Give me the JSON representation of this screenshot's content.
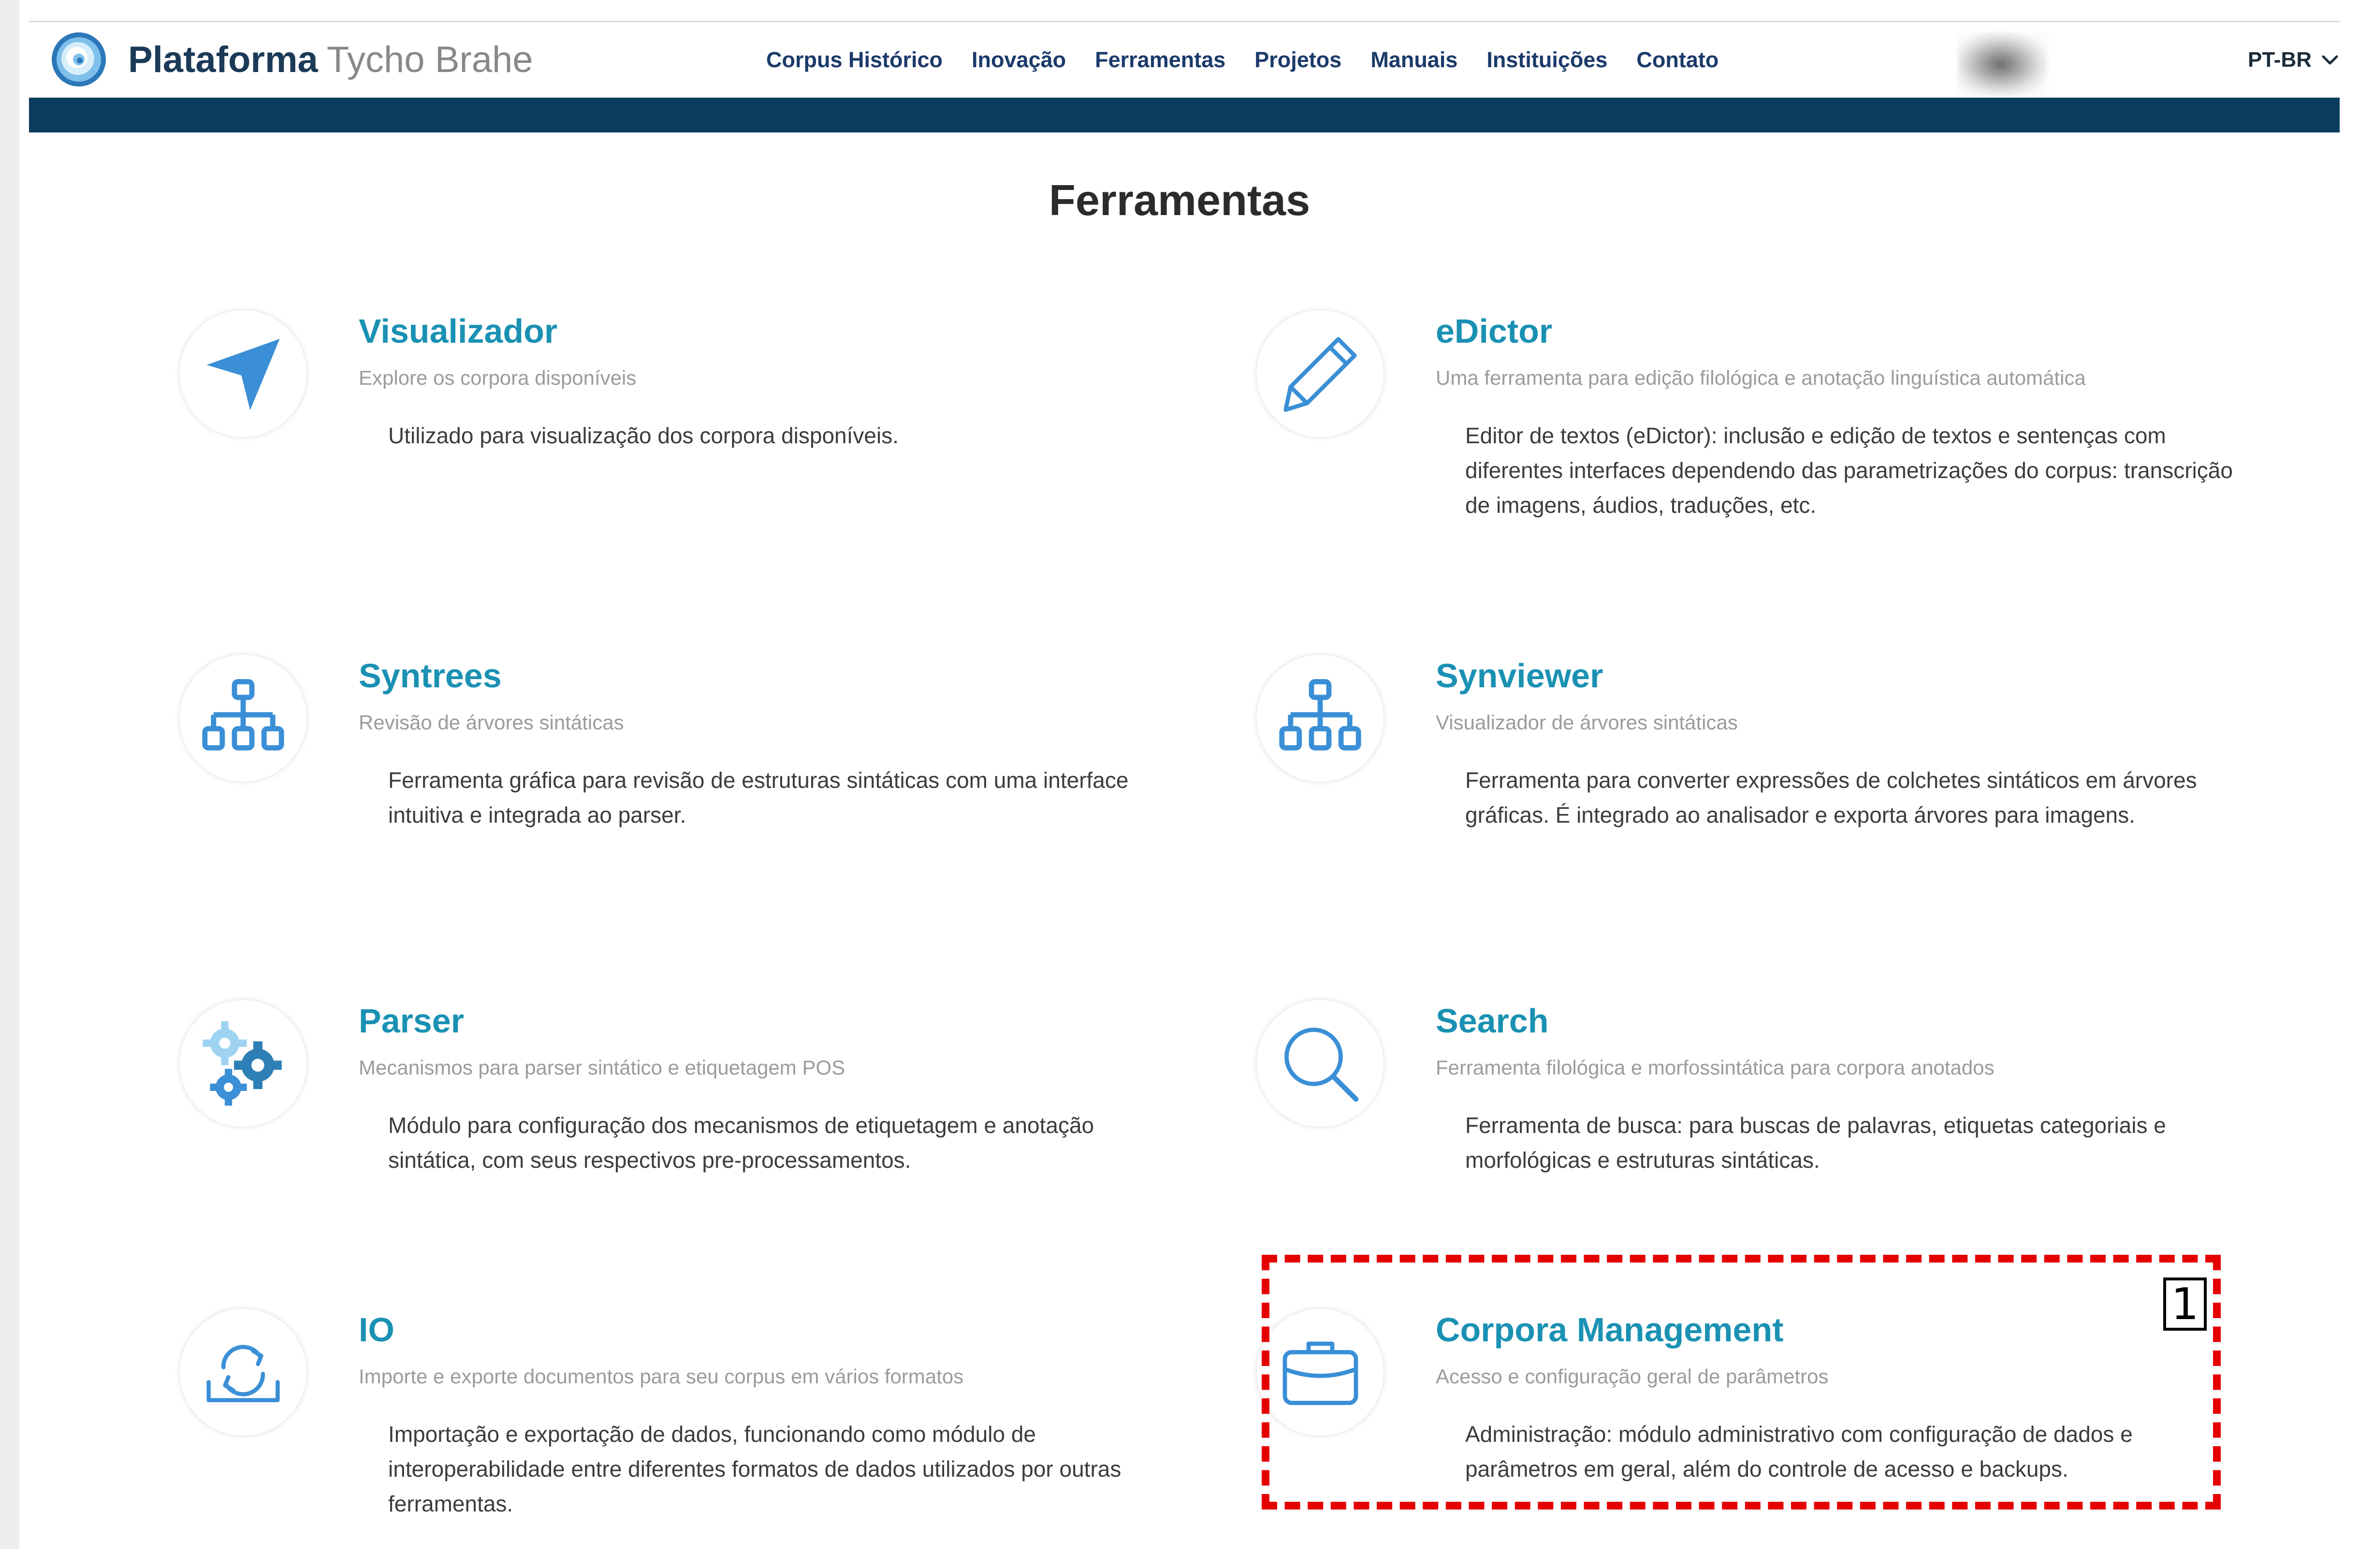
{
  "header": {
    "brand_bold": "Plataforma",
    "brand_light": "Tycho Brahe",
    "nav": [
      {
        "label": "Corpus Histórico"
      },
      {
        "label": "Inovação"
      },
      {
        "label": "Ferramentas"
      },
      {
        "label": "Projetos"
      },
      {
        "label": "Manuais"
      },
      {
        "label": "Instituições"
      },
      {
        "label": "Contato"
      }
    ],
    "language": "PT-BR",
    "accent_color": "#0c3c5d"
  },
  "page": {
    "title": "Ferramentas"
  },
  "tools": [
    {
      "title": "Visualizador",
      "subtitle": "Explore os corpora disponíveis",
      "description": "Utilizado para visualização dos corpora disponíveis.",
      "icon": "paper-plane-icon"
    },
    {
      "title": "eDictor",
      "subtitle": "Uma ferramenta para edição filológica e anotação linguística automática",
      "description": "Editor de textos (eDictor): inclusão e edição de textos e sentenças com diferentes interfaces dependendo das parametrizações do corpus: transcrição de imagens, áudios, traduções, etc.",
      "icon": "pencil-icon"
    },
    {
      "title": "Syntrees",
      "subtitle": "Revisão de árvores sintáticas",
      "description": "Ferramenta gráfica para revisão de estruturas sintáticas com uma interface intuitiva e integrada ao parser.",
      "icon": "tree-structure-icon"
    },
    {
      "title": "Synviewer",
      "subtitle": "Visualizador de árvores sintáticas",
      "description": "Ferramenta para converter expressões de colchetes sintáticos em árvores gráficas. É integrado ao analisador e exporta árvores para imagens.",
      "icon": "tree-structure-icon"
    },
    {
      "title": "Parser",
      "subtitle": "Mecanismos para parser sintático e etiquetagem POS",
      "description": "Módulo para configuração dos mecanismos de etiquetagem e anotação sintática, com seus respectivos pre-processamentos.",
      "icon": "gears-icon"
    },
    {
      "title": "Search",
      "subtitle": "Ferramenta filológica e morfossintática para corpora anotados",
      "description": "Ferramenta de busca: para buscas de palavras, etiquetas categoriais e morfológicas e estruturas sintáticas.",
      "icon": "magnifier-icon"
    },
    {
      "title": "IO",
      "subtitle": "Importe e exporte documentos para seu corpus em vários formatos",
      "description": "Importação e exportação de dados, funcionando como módulo de interoperabilidade entre diferentes formatos de dados utilizados por outras ferramentas.",
      "icon": "import-export-icon"
    },
    {
      "title": "Corpora Management",
      "subtitle": "Acesso e configuração geral de parâmetros",
      "description": "Administração: módulo administrativo com configuração de dados e parâmetros em geral, além do controle de acesso e backups.",
      "icon": "briefcase-icon"
    }
  ],
  "annotation": {
    "label": "1",
    "color": "#e50000"
  },
  "colors": {
    "tool_title": "#1a91b3",
    "icon_blue": "#3a8fd6",
    "nav_text": "#1b3a6b"
  }
}
